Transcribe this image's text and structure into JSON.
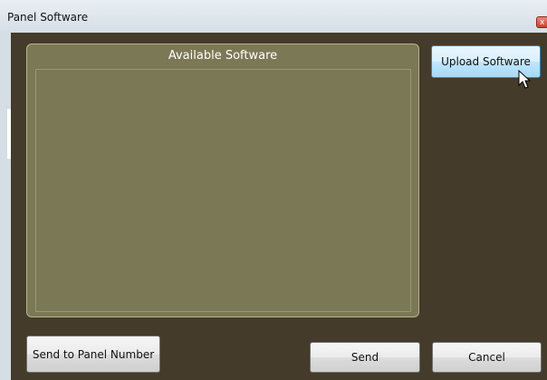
{
  "window": {
    "title": "Panel Software",
    "close_glyph": "x"
  },
  "software_panel": {
    "title": "Available Software",
    "items": []
  },
  "buttons": {
    "upload_label": "Upload Software",
    "send_to_panel_label": "Send to Panel Number",
    "send_label": "Send",
    "cancel_label": "Cancel"
  },
  "icons": {
    "close": "close-icon",
    "cursor": "mouse-pointer-icon"
  },
  "colors": {
    "background": "#443b2a",
    "panel": "#7b7855",
    "panel_border": "#b7b38f",
    "hover_button": "#bee6fd"
  }
}
